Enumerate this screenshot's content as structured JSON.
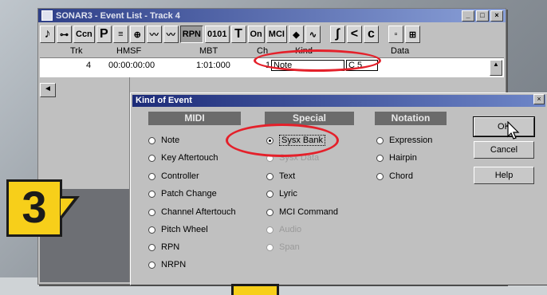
{
  "event_window": {
    "title": "SONAR3 - Event List - Track 4",
    "controls": [
      "_",
      "□",
      "×"
    ],
    "toolbar": [
      "♪",
      "⊶",
      "Ccn",
      "P",
      "≡",
      "⊕",
      "〰",
      "〰",
      "RPN",
      "0101",
      "T",
      "On",
      "MCI",
      "◆",
      "∿",
      "∫",
      "<",
      "c",
      "▫",
      "⊞"
    ],
    "columns": {
      "trk": "Trk",
      "hmsf": "HMSF",
      "mbt": "MBT",
      "ch": "Ch",
      "kind": "Kind",
      "data": "Data"
    },
    "row": {
      "trk": "4",
      "hmsf": "00:00:00:00",
      "mbt": "1:01:000",
      "ch": "1",
      "kind": "Note",
      "data": "C 5"
    }
  },
  "dialog": {
    "title": "Kind of Event",
    "close": "×",
    "groups": {
      "midi": {
        "label": "MIDI",
        "items": [
          "Note",
          "Key Aftertouch",
          "Controller",
          "Patch Change",
          "Channel Aftertouch",
          "Pitch Wheel",
          "RPN",
          "NRPN"
        ]
      },
      "special": {
        "label": "Special",
        "items": [
          "Sysx Bank",
          "Sysx Data",
          "Text",
          "Lyric",
          "MCI Command",
          "Audio",
          "Span"
        ],
        "selected": "Sysx Bank"
      },
      "notation": {
        "label": "Notation",
        "items": [
          "Expression",
          "Hairpin",
          "Chord"
        ]
      }
    },
    "buttons": {
      "ok": "OK",
      "cancel": "Cancel",
      "help": "Help"
    }
  },
  "step_badge": "3",
  "colors": {
    "highlight": "#e4202a",
    "badge": "#f7cf1a",
    "title_bar": "#2e3f88"
  }
}
